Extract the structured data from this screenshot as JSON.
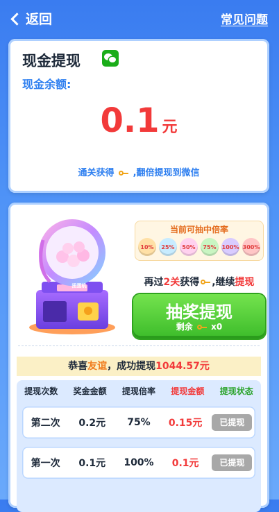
{
  "header": {
    "back_label": "返回",
    "faq_label": "常见问题"
  },
  "cash_card": {
    "title": "现金提现",
    "balance_label": "现金余额:",
    "amount": "0.1",
    "unit": "元",
    "hint_before": "通关获得",
    "hint_after": ",翻倍提现到微信"
  },
  "lottery": {
    "machine_sign": "扭蛋机",
    "multiplier_title": "当前可抽中倍率",
    "multipliers": [
      "10%",
      "25%",
      "50%",
      "75%",
      "100%",
      "300%"
    ],
    "continue_pre": "再过",
    "continue_num": "2关",
    "continue_mid": "获得",
    "continue_post": ",继续",
    "continue_red": "提现",
    "draw_label": "抽奖提现",
    "remaining_label": "剩余",
    "remaining_count": "x0"
  },
  "congrats": {
    "pre": "恭喜",
    "name": "友谊",
    "mid": "，成功提现",
    "amount": "1044.57元"
  },
  "table": {
    "headers": [
      "提现次数",
      "奖金金额",
      "提现倍率",
      "提现金额",
      "提现状态"
    ],
    "rows": [
      {
        "times": "第二次",
        "bonus": "0.2元",
        "rate": "75%",
        "withdraw": "0.15元",
        "status": "已提现"
      },
      {
        "times": "第一次",
        "bonus": "0.1元",
        "rate": "100%",
        "withdraw": "0.1元",
        "status": "已提现"
      }
    ]
  },
  "colors": {
    "accent_blue": "#2e7ff0",
    "amount_red": "#f23a3a",
    "button_green": "#3cbc2a",
    "wechat_green": "#1aad19"
  },
  "icons": {
    "back": "chevron-left-icon",
    "wechat": "wechat-icon",
    "key": "key-icon"
  }
}
